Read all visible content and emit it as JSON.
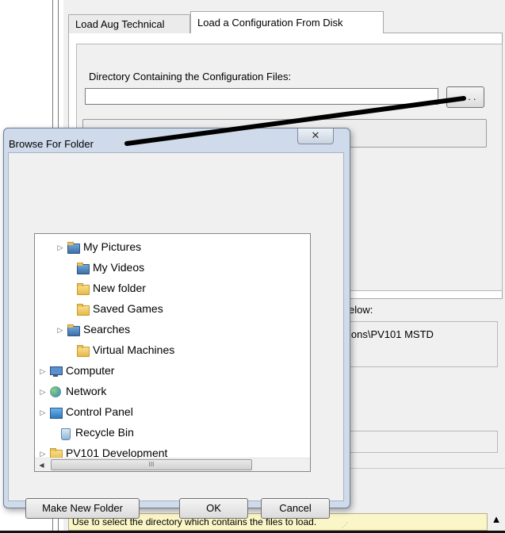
{
  "app": {
    "tabs": [
      "Load Aug Technical",
      "Load a Configuration From Disk"
    ],
    "directory_label": "Directory Containing the Configuration Files:",
    "directory_value": "",
    "browse_button_label": ". . .",
    "below_label": "elow:",
    "path_text": "ions\\PV101 MSTD",
    "status_text": "Use to select the directory which contains the files to load.",
    "status_arrow": "▲"
  },
  "dialog": {
    "title": "Browse For Folder",
    "close_label": "✕",
    "tree": [
      {
        "label": "My Pictures",
        "icon": "folder-pictures-icon",
        "expander": true
      },
      {
        "label": "My Videos",
        "icon": "folder-videos-icon",
        "expander": false
      },
      {
        "label": "New folder",
        "icon": "folder-icon",
        "expander": false
      },
      {
        "label": "Saved Games",
        "icon": "folder-saved-games-icon",
        "expander": false
      },
      {
        "label": "Searches",
        "icon": "folder-searches-icon",
        "expander": true
      },
      {
        "label": "Virtual Machines",
        "icon": "folder-icon",
        "expander": false
      },
      {
        "label": "Computer",
        "icon": "computer-icon",
        "expander": true
      },
      {
        "label": "Network",
        "icon": "network-icon",
        "expander": true
      },
      {
        "label": "Control Panel",
        "icon": "control-panel-icon",
        "expander": true
      },
      {
        "label": "Recycle Bin",
        "icon": "recycle-bin-icon",
        "expander": false
      },
      {
        "label": "PV101 Development",
        "icon": "folder-icon",
        "expander": true
      }
    ],
    "hscroll_thumb": "III",
    "vscroll_thumb": "≡",
    "buttons": {
      "make_new_folder": "Make New Folder",
      "ok": "OK",
      "cancel": "Cancel"
    }
  },
  "colors": {
    "status_background": "#fbf6c7",
    "dialog_frame": "#cfdbea"
  }
}
